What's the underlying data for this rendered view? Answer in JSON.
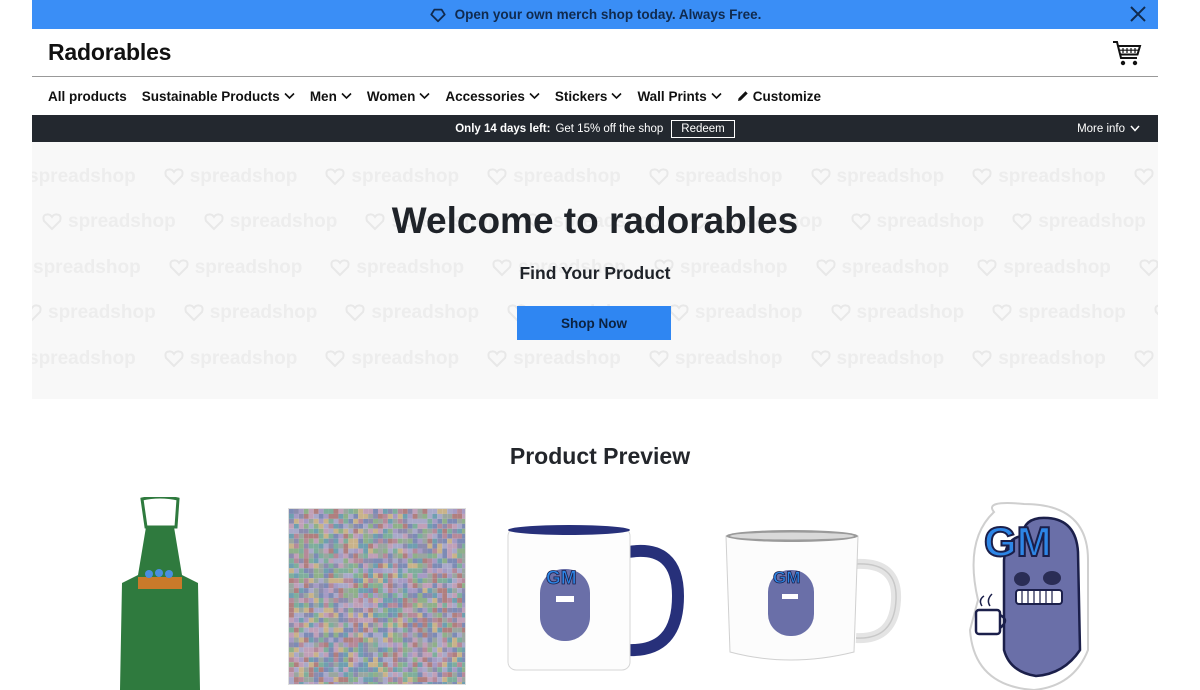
{
  "promo": {
    "text": "Open your own merch shop today. Always Free."
  },
  "header": {
    "logo": "Radorables"
  },
  "nav": {
    "items": [
      {
        "label": "All products",
        "dropdown": false
      },
      {
        "label": "Sustainable Products",
        "dropdown": true
      },
      {
        "label": "Men",
        "dropdown": true
      },
      {
        "label": "Women",
        "dropdown": true
      },
      {
        "label": "Accessories",
        "dropdown": true
      },
      {
        "label": "Stickers",
        "dropdown": true
      },
      {
        "label": "Wall Prints",
        "dropdown": true
      },
      {
        "label": "Customize",
        "dropdown": false
      }
    ]
  },
  "offer": {
    "bold": "Only 14 days left:",
    "text": "Get 15% off the shop",
    "redeem": "Redeem",
    "more_info": "More info"
  },
  "hero": {
    "title": "Welcome to radorables",
    "subtitle": "Find Your Product",
    "button": "Shop Now",
    "pattern_word": "spreadshop"
  },
  "preview": {
    "title": "Product Preview",
    "sticker_text": "GM"
  },
  "colors": {
    "promo_bg": "#3a8ef6",
    "dark_bar": "#23282f",
    "button": "#2f86f2",
    "apron": "#2f7a3e",
    "mug_blue": "#27307a",
    "creature": "#6a6fa8"
  }
}
